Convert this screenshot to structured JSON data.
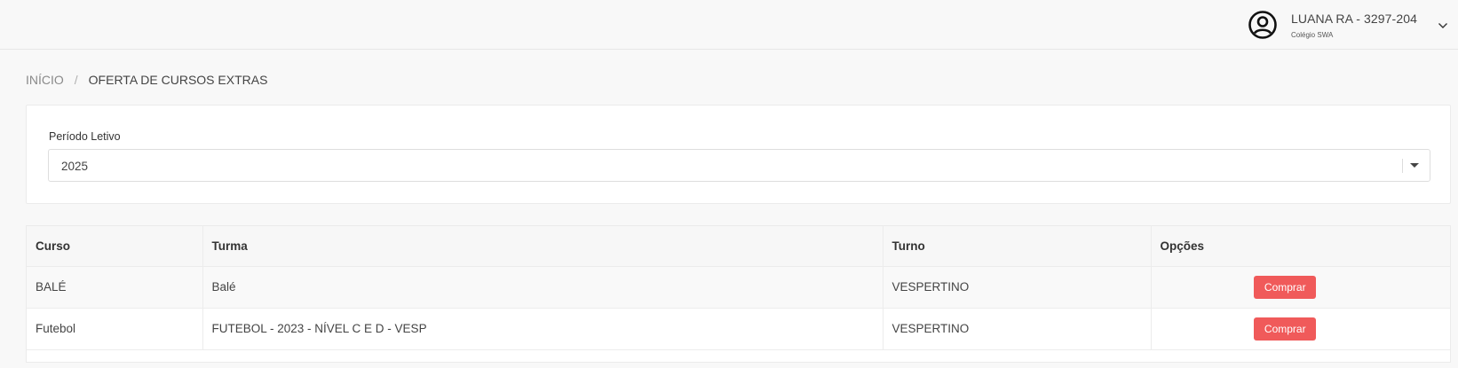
{
  "header": {
    "user_name": "LUANA RA - 3297-204",
    "school": "Colégio SWA",
    "avatar_icon": "user-circle-icon",
    "menu_icon": "chevron-down-icon"
  },
  "breadcrumb": {
    "home": "INÍCIO",
    "separator": "/",
    "current": "OFERTA DE CURSOS EXTRAS"
  },
  "filter": {
    "label": "Período Letivo",
    "selected": "2025"
  },
  "table": {
    "columns": [
      "Curso",
      "Turma",
      "Turno",
      "Opções"
    ],
    "rows": [
      {
        "curso": "BALÉ",
        "turma": "Balé",
        "turno": "VESPERTINO",
        "action": "Comprar"
      },
      {
        "curso": "Futebol",
        "turma": "FUTEBOL - 2023 - NÍVEL C E D - VESP",
        "turno": "VESPERTINO",
        "action": "Comprar"
      }
    ]
  },
  "colors": {
    "accent_button": "#f05a5a",
    "background": "#f8f8f8"
  }
}
